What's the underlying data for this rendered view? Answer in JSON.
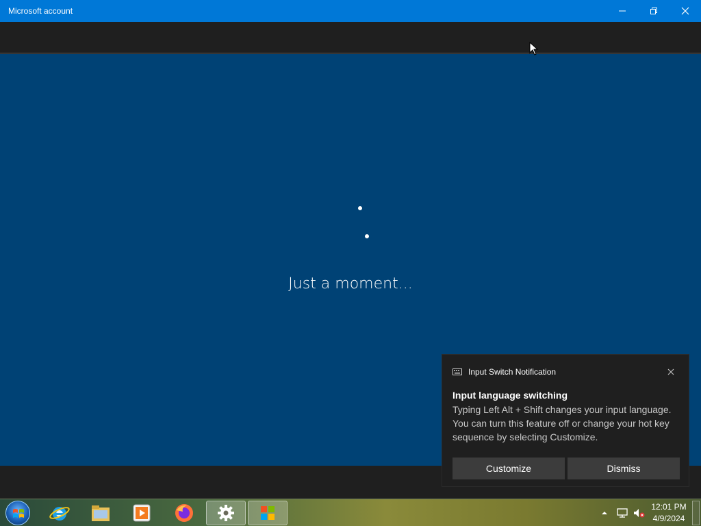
{
  "window": {
    "title": "Microsoft account",
    "controls": {
      "minimize": "minimize-icon",
      "maximize": "restore-icon",
      "close": "close-icon"
    }
  },
  "content": {
    "status_text": "Just a moment...",
    "background_color": "#004275"
  },
  "notification": {
    "app_name": "Input Switch Notification",
    "title": "Input language switching",
    "body": "Typing Left Alt + Shift changes your input language. You can turn this feature off or change your hot key sequence by selecting Customize.",
    "buttons": {
      "customize": "Customize",
      "dismiss": "Dismiss"
    }
  },
  "taskbar": {
    "items": [
      "internet-explorer-icon",
      "file-explorer-icon",
      "media-player-icon",
      "firefox-icon",
      "settings-icon",
      "microsoft-store-icon"
    ],
    "clock": {
      "time": "12:01 PM",
      "date": "4/9/2024"
    }
  },
  "colors": {
    "accent": "#0078d7",
    "dark": "#1f1f1f"
  }
}
